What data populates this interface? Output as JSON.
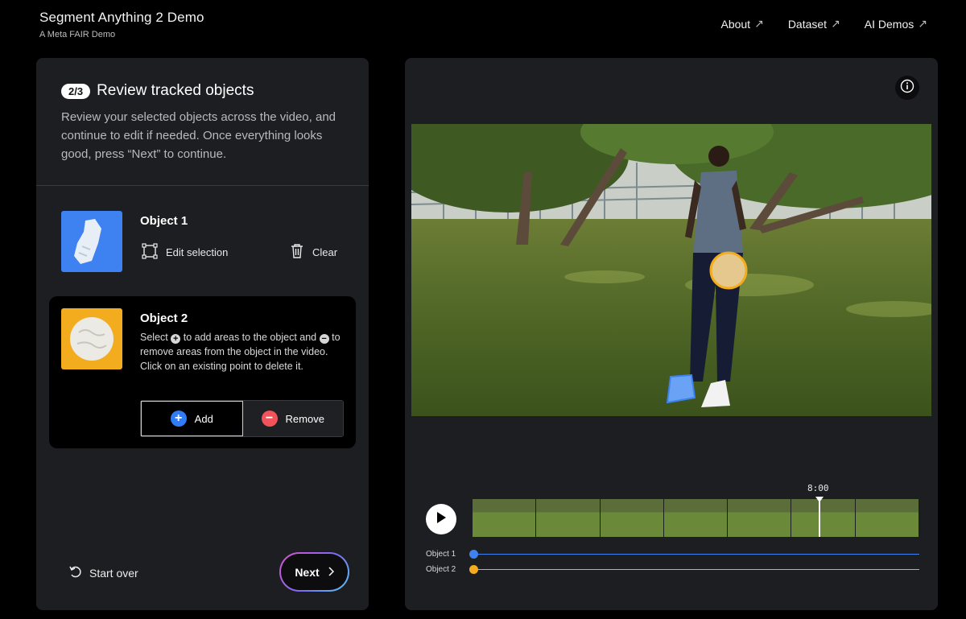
{
  "header": {
    "title": "Segment Anything 2 Demo",
    "subtitle": "A Meta FAIR Demo",
    "nav": [
      {
        "label": "About",
        "icon": "external-arrow-icon"
      },
      {
        "label": "Dataset",
        "icon": "external-arrow-icon"
      },
      {
        "label": "AI Demos",
        "icon": "external-arrow-icon"
      }
    ]
  },
  "step": {
    "badge": "2/3",
    "title": "Review tracked objects",
    "description": "Review your selected objects across the video, and continue to edit if needed. Once everything looks good, press “Next” to continue."
  },
  "objects": [
    {
      "name": "Object 1",
      "edit_label": "Edit selection",
      "clear_label": "Clear",
      "color": "#3d82f0"
    },
    {
      "name": "Object 2",
      "color": "#f3ac1d",
      "desc_part1": "Select",
      "desc_part2": "to add areas to the object and",
      "desc_part3": "to remove areas from the object in the video. Click on an existing point to delete it.",
      "add_label": "Add",
      "remove_label": "Remove"
    }
  ],
  "footer": {
    "start_over_label": "Start over",
    "next_label": "Next"
  },
  "timeline": {
    "time": "8:00",
    "tracks": [
      {
        "label": "Object 1",
        "color": "#3d82f0"
      },
      {
        "label": "Object 2",
        "color": "#f3ac1d"
      }
    ]
  }
}
